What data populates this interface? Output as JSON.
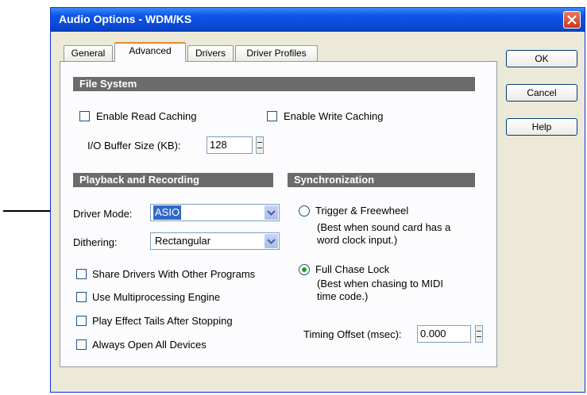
{
  "window": {
    "title": "Audio Options - WDM/KS"
  },
  "tabs": [
    {
      "label": "General"
    },
    {
      "label": "Advanced",
      "active": true
    },
    {
      "label": "Drivers"
    },
    {
      "label": "Driver Profiles"
    }
  ],
  "buttons": {
    "ok": "OK",
    "cancel": "Cancel",
    "help": "Help"
  },
  "file_system": {
    "header": "File System",
    "enable_read_caching": {
      "label": "Enable Read Caching",
      "checked": false
    },
    "enable_write_caching": {
      "label": "Enable Write Caching",
      "checked": false
    },
    "io_buffer_label": "I/O Buffer Size (KB):",
    "io_buffer_value": "128"
  },
  "playback": {
    "header": "Playback and Recording",
    "driver_mode_label": "Driver Mode:",
    "driver_mode_value": "ASIO",
    "dithering_label": "Dithering:",
    "dithering_value": "Rectangular",
    "options": [
      {
        "label": "Share Drivers With Other Programs",
        "checked": false
      },
      {
        "label": "Use Multiprocessing Engine",
        "checked": false
      },
      {
        "label": "Play Effect Tails After Stopping",
        "checked": false
      },
      {
        "label": "Always Open All Devices",
        "checked": false
      }
    ]
  },
  "sync": {
    "header": "Synchronization",
    "trigger": {
      "label": "Trigger & Freewheel",
      "note1": "(Best when sound card has a",
      "note2": "word clock input.)",
      "selected": false
    },
    "chase": {
      "label": "Full Chase Lock",
      "note1": "(Best when chasing to MIDI",
      "note2": "time code.)",
      "selected": true
    },
    "timing_offset_label": "Timing Offset (msec):",
    "timing_offset_value": "0.000"
  },
  "colors": {
    "title_bar": "#0a4bd8",
    "section_bg": "#6b6b6b",
    "dialog_bg": "#ece9d8",
    "selection": "#316ac5"
  }
}
